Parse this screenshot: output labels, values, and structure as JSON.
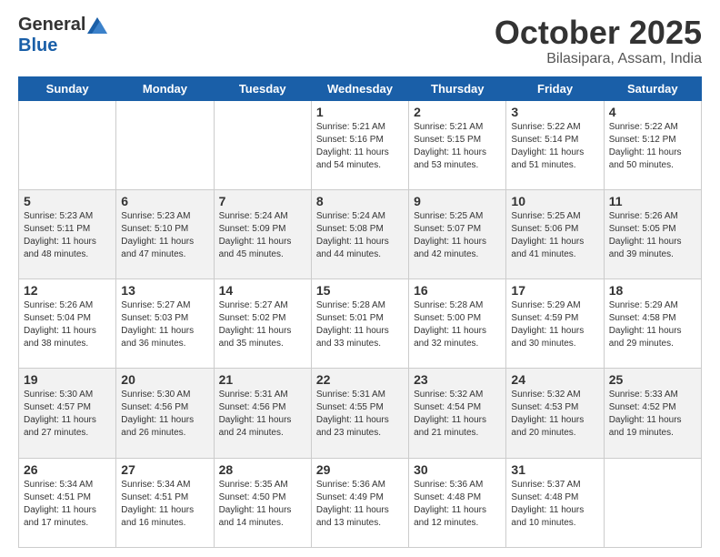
{
  "header": {
    "logo_general": "General",
    "logo_blue": "Blue",
    "month_title": "October 2025",
    "location": "Bilasipara, Assam, India"
  },
  "days_of_week": [
    "Sunday",
    "Monday",
    "Tuesday",
    "Wednesday",
    "Thursday",
    "Friday",
    "Saturday"
  ],
  "weeks": [
    {
      "cells": [
        {
          "day": null,
          "sunrise": null,
          "sunset": null,
          "daylight": null
        },
        {
          "day": null,
          "sunrise": null,
          "sunset": null,
          "daylight": null
        },
        {
          "day": null,
          "sunrise": null,
          "sunset": null,
          "daylight": null
        },
        {
          "day": "1",
          "sunrise": "Sunrise: 5:21 AM",
          "sunset": "Sunset: 5:16 PM",
          "daylight": "Daylight: 11 hours and 54 minutes."
        },
        {
          "day": "2",
          "sunrise": "Sunrise: 5:21 AM",
          "sunset": "Sunset: 5:15 PM",
          "daylight": "Daylight: 11 hours and 53 minutes."
        },
        {
          "day": "3",
          "sunrise": "Sunrise: 5:22 AM",
          "sunset": "Sunset: 5:14 PM",
          "daylight": "Daylight: 11 hours and 51 minutes."
        },
        {
          "day": "4",
          "sunrise": "Sunrise: 5:22 AM",
          "sunset": "Sunset: 5:12 PM",
          "daylight": "Daylight: 11 hours and 50 minutes."
        }
      ]
    },
    {
      "cells": [
        {
          "day": "5",
          "sunrise": "Sunrise: 5:23 AM",
          "sunset": "Sunset: 5:11 PM",
          "daylight": "Daylight: 11 hours and 48 minutes."
        },
        {
          "day": "6",
          "sunrise": "Sunrise: 5:23 AM",
          "sunset": "Sunset: 5:10 PM",
          "daylight": "Daylight: 11 hours and 47 minutes."
        },
        {
          "day": "7",
          "sunrise": "Sunrise: 5:24 AM",
          "sunset": "Sunset: 5:09 PM",
          "daylight": "Daylight: 11 hours and 45 minutes."
        },
        {
          "day": "8",
          "sunrise": "Sunrise: 5:24 AM",
          "sunset": "Sunset: 5:08 PM",
          "daylight": "Daylight: 11 hours and 44 minutes."
        },
        {
          "day": "9",
          "sunrise": "Sunrise: 5:25 AM",
          "sunset": "Sunset: 5:07 PM",
          "daylight": "Daylight: 11 hours and 42 minutes."
        },
        {
          "day": "10",
          "sunrise": "Sunrise: 5:25 AM",
          "sunset": "Sunset: 5:06 PM",
          "daylight": "Daylight: 11 hours and 41 minutes."
        },
        {
          "day": "11",
          "sunrise": "Sunrise: 5:26 AM",
          "sunset": "Sunset: 5:05 PM",
          "daylight": "Daylight: 11 hours and 39 minutes."
        }
      ]
    },
    {
      "cells": [
        {
          "day": "12",
          "sunrise": "Sunrise: 5:26 AM",
          "sunset": "Sunset: 5:04 PM",
          "daylight": "Daylight: 11 hours and 38 minutes."
        },
        {
          "day": "13",
          "sunrise": "Sunrise: 5:27 AM",
          "sunset": "Sunset: 5:03 PM",
          "daylight": "Daylight: 11 hours and 36 minutes."
        },
        {
          "day": "14",
          "sunrise": "Sunrise: 5:27 AM",
          "sunset": "Sunset: 5:02 PM",
          "daylight": "Daylight: 11 hours and 35 minutes."
        },
        {
          "day": "15",
          "sunrise": "Sunrise: 5:28 AM",
          "sunset": "Sunset: 5:01 PM",
          "daylight": "Daylight: 11 hours and 33 minutes."
        },
        {
          "day": "16",
          "sunrise": "Sunrise: 5:28 AM",
          "sunset": "Sunset: 5:00 PM",
          "daylight": "Daylight: 11 hours and 32 minutes."
        },
        {
          "day": "17",
          "sunrise": "Sunrise: 5:29 AM",
          "sunset": "Sunset: 4:59 PM",
          "daylight": "Daylight: 11 hours and 30 minutes."
        },
        {
          "day": "18",
          "sunrise": "Sunrise: 5:29 AM",
          "sunset": "Sunset: 4:58 PM",
          "daylight": "Daylight: 11 hours and 29 minutes."
        }
      ]
    },
    {
      "cells": [
        {
          "day": "19",
          "sunrise": "Sunrise: 5:30 AM",
          "sunset": "Sunset: 4:57 PM",
          "daylight": "Daylight: 11 hours and 27 minutes."
        },
        {
          "day": "20",
          "sunrise": "Sunrise: 5:30 AM",
          "sunset": "Sunset: 4:56 PM",
          "daylight": "Daylight: 11 hours and 26 minutes."
        },
        {
          "day": "21",
          "sunrise": "Sunrise: 5:31 AM",
          "sunset": "Sunset: 4:56 PM",
          "daylight": "Daylight: 11 hours and 24 minutes."
        },
        {
          "day": "22",
          "sunrise": "Sunrise: 5:31 AM",
          "sunset": "Sunset: 4:55 PM",
          "daylight": "Daylight: 11 hours and 23 minutes."
        },
        {
          "day": "23",
          "sunrise": "Sunrise: 5:32 AM",
          "sunset": "Sunset: 4:54 PM",
          "daylight": "Daylight: 11 hours and 21 minutes."
        },
        {
          "day": "24",
          "sunrise": "Sunrise: 5:32 AM",
          "sunset": "Sunset: 4:53 PM",
          "daylight": "Daylight: 11 hours and 20 minutes."
        },
        {
          "day": "25",
          "sunrise": "Sunrise: 5:33 AM",
          "sunset": "Sunset: 4:52 PM",
          "daylight": "Daylight: 11 hours and 19 minutes."
        }
      ]
    },
    {
      "cells": [
        {
          "day": "26",
          "sunrise": "Sunrise: 5:34 AM",
          "sunset": "Sunset: 4:51 PM",
          "daylight": "Daylight: 11 hours and 17 minutes."
        },
        {
          "day": "27",
          "sunrise": "Sunrise: 5:34 AM",
          "sunset": "Sunset: 4:51 PM",
          "daylight": "Daylight: 11 hours and 16 minutes."
        },
        {
          "day": "28",
          "sunrise": "Sunrise: 5:35 AM",
          "sunset": "Sunset: 4:50 PM",
          "daylight": "Daylight: 11 hours and 14 minutes."
        },
        {
          "day": "29",
          "sunrise": "Sunrise: 5:36 AM",
          "sunset": "Sunset: 4:49 PM",
          "daylight": "Daylight: 11 hours and 13 minutes."
        },
        {
          "day": "30",
          "sunrise": "Sunrise: 5:36 AM",
          "sunset": "Sunset: 4:48 PM",
          "daylight": "Daylight: 11 hours and 12 minutes."
        },
        {
          "day": "31",
          "sunrise": "Sunrise: 5:37 AM",
          "sunset": "Sunset: 4:48 PM",
          "daylight": "Daylight: 11 hours and 10 minutes."
        },
        {
          "day": null,
          "sunrise": null,
          "sunset": null,
          "daylight": null
        }
      ]
    }
  ]
}
